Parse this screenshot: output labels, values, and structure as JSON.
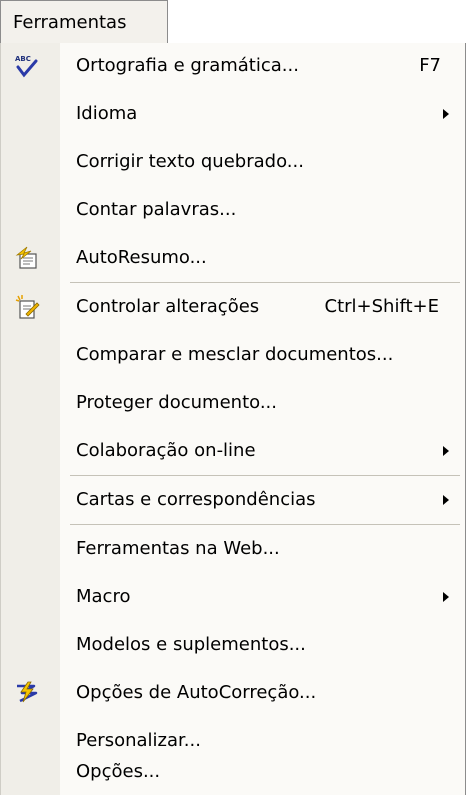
{
  "menubar": {
    "title": "Ferramentas"
  },
  "menu": {
    "items": [
      {
        "label": "Ortografia e gramática...",
        "shortcut": "F7",
        "icon": "spell-check-icon"
      },
      {
        "label": "Idioma",
        "submenu": true
      },
      {
        "label": "Corrigir texto quebrado..."
      },
      {
        "label": "Contar palavras..."
      },
      {
        "label": "AutoResumo...",
        "icon": "autosummary-icon"
      },
      {
        "label": "Controlar alterações",
        "shortcut": "Ctrl+Shift+E",
        "icon": "track-changes-icon"
      },
      {
        "label": "Comparar e mesclar documentos..."
      },
      {
        "label": "Proteger documento..."
      },
      {
        "label": "Colaboração on-line",
        "submenu": true
      },
      {
        "label": "Cartas e correspondências",
        "submenu": true
      },
      {
        "label": "Ferramentas na Web..."
      },
      {
        "label": "Macro",
        "submenu": true
      },
      {
        "label": "Modelos e suplementos..."
      },
      {
        "label": "Opções de AutoCorreção...",
        "icon": "autocorrect-icon"
      },
      {
        "label": "Personalizar..."
      },
      {
        "label": "Opções..."
      }
    ]
  }
}
